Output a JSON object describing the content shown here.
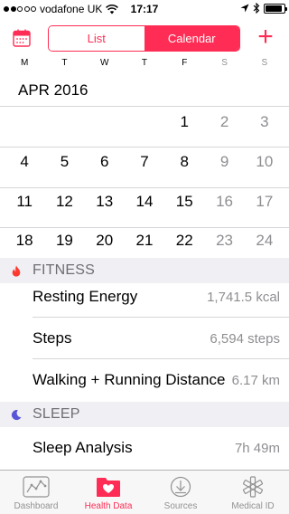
{
  "status": {
    "carrier": "vodafone UK",
    "time": "17:17",
    "signal_bars_filled": 2,
    "signal_bars_total": 5,
    "battery_level": 0.9
  },
  "nav": {
    "segments": [
      "List",
      "Calendar"
    ],
    "selected_segment": "Calendar",
    "add_label": "+",
    "accent_color": "#ff2d55"
  },
  "weekdays": [
    "M",
    "T",
    "W",
    "T",
    "F",
    "S",
    "S"
  ],
  "calendar": {
    "month_title": "APR 2016",
    "rows": [
      [
        "",
        "",
        "",
        "",
        "1",
        "2",
        "3"
      ],
      [
        "4",
        "5",
        "6",
        "7",
        "8",
        "9",
        "10"
      ],
      [
        "11",
        "12",
        "13",
        "14",
        "15",
        "16",
        "17"
      ],
      [
        "18",
        "19",
        "20",
        "21",
        "22",
        "23",
        "24"
      ]
    ]
  },
  "sections": {
    "fitness": {
      "title": "FITNESS",
      "icon": "flame-icon",
      "color": "#ff3b30",
      "rows": [
        {
          "label": "Resting Energy",
          "value": "1,741.5",
          "unit": "kcal"
        },
        {
          "label": "Steps",
          "value": "6,594",
          "unit": "steps"
        },
        {
          "label": "Walking + Running Distance",
          "value": "6.17",
          "unit": "km"
        }
      ]
    },
    "sleep": {
      "title": "SLEEP",
      "icon": "moon-icon",
      "color": "#5856d6",
      "rows": [
        {
          "label": "Sleep Analysis",
          "value": "7h 49m",
          "unit": ""
        }
      ]
    }
  },
  "tabs": [
    {
      "label": "Dashboard",
      "icon": "dashboard-icon",
      "active": false
    },
    {
      "label": "Health Data",
      "icon": "health-data-icon",
      "active": true
    },
    {
      "label": "Sources",
      "icon": "sources-icon",
      "active": false
    },
    {
      "label": "Medical ID",
      "icon": "medical-id-icon",
      "active": false
    }
  ]
}
